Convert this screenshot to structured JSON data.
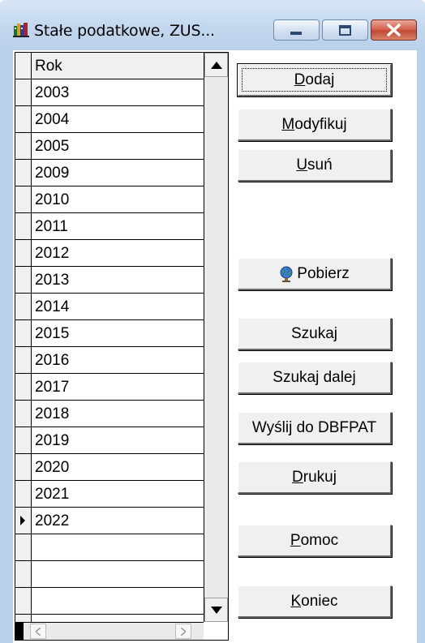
{
  "window": {
    "title": "Stałe podatkowe, ZUS..."
  },
  "grid": {
    "column_header": "Rok",
    "rows": [
      "2003",
      "2004",
      "2005",
      "2009",
      "2010",
      "2011",
      "2012",
      "2013",
      "2014",
      "2015",
      "2016",
      "2017",
      "2018",
      "2019",
      "2020",
      "2021",
      "2022"
    ],
    "current_row": "2022"
  },
  "buttons": {
    "dodaj": {
      "hotkey": "D",
      "rest": "odaj"
    },
    "modyfikuj": {
      "hotkey": "M",
      "rest": "odyfikuj"
    },
    "usun": {
      "hotkey": "U",
      "rest": "suń"
    },
    "pobierz": "Pobierz",
    "szukaj": "Szukaj",
    "szukaj_dalej": "Szukaj dalej",
    "wyslij": "Wyślij do DBFPAT",
    "drukuj": {
      "hotkey": "D",
      "rest": "rukuj"
    },
    "pomoc": {
      "hotkey": "P",
      "rest": "omoc"
    },
    "koniec": {
      "hotkey": "K",
      "rest": "oniec"
    }
  },
  "icons": {
    "app": "database-books-icon",
    "pobierz": "globe-icon",
    "minimize": "minimize-icon",
    "maximize": "maximize-icon",
    "close": "close-icon"
  },
  "colors": {
    "titlebar": "#c3d8ef",
    "close_button": "#c94b35",
    "button_face": "#f0f0f0"
  }
}
